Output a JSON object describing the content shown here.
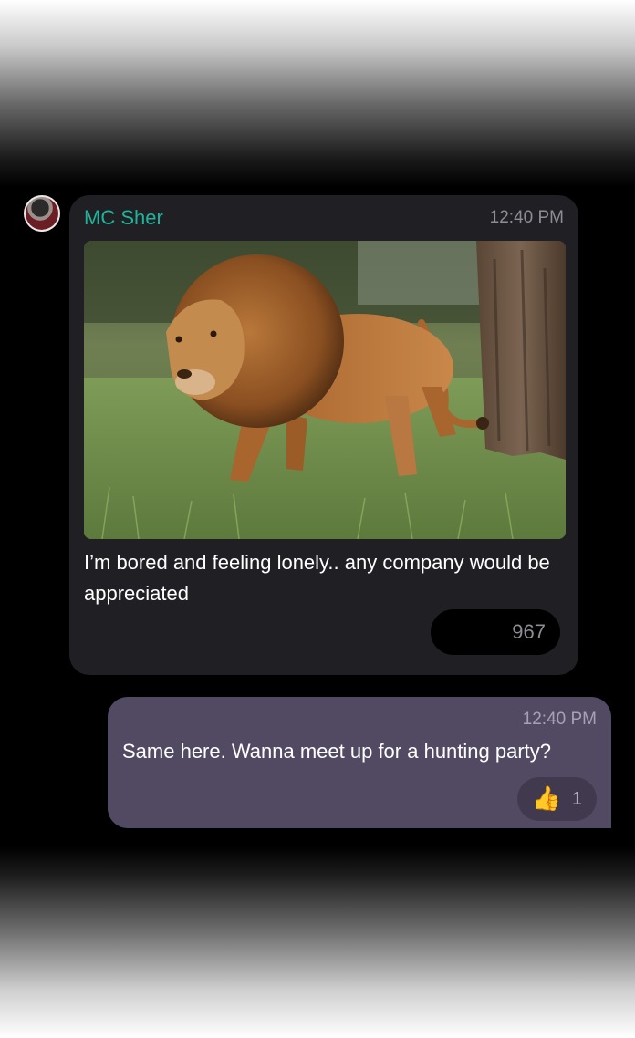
{
  "incoming": {
    "sender": "MC Sher",
    "time": "12:40 PM",
    "image_alt": "lion walking on grass",
    "text": "I’m bored and feeling lonely.. any company would be appreciated",
    "reactions": {
      "emoji": [
        "😂",
        "😔"
      ],
      "count": "967"
    }
  },
  "outgoing": {
    "time": "12:40 PM",
    "text": "Same here. Wanna meet up for a hunting party?",
    "reactions": {
      "emoji": [
        "👍"
      ],
      "count": "1"
    }
  },
  "colors": {
    "sender_name": "#1fb49a",
    "incoming_bubble": "#1f1f24",
    "outgoing_bubble": "#524a63"
  }
}
